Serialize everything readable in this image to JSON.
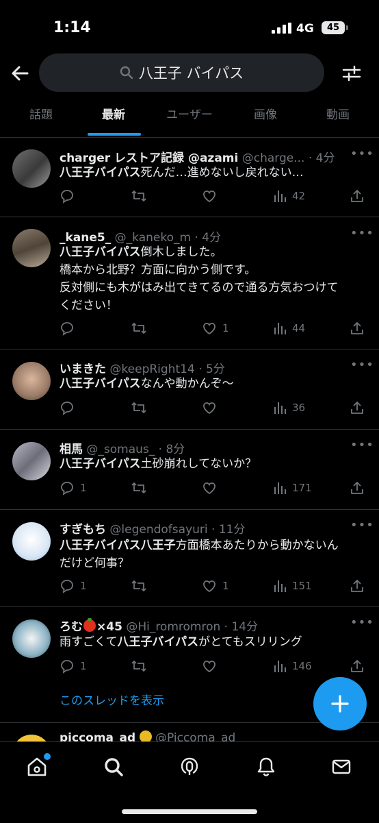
{
  "status": {
    "time": "1:14",
    "network": "4G",
    "battery": "45"
  },
  "search": {
    "query": "八王子 バイパス"
  },
  "tabs": [
    "話題",
    "最新",
    "ユーザー",
    "画像",
    "動画"
  ],
  "tweets": [
    {
      "name": "charger レストア記録 @azami",
      "meta": "@charge... · 4分",
      "text_bold": "八王子バイパス",
      "text": "死んだ…進めないし戻れない…",
      "replies": "",
      "likes": "",
      "views": "42"
    },
    {
      "name": "_kane5_",
      "meta": "@_kaneko_m · 4分",
      "text_bold": "八王子バイパス",
      "text": "倒木しました。",
      "lines": [
        "橋本から北野？方面に向かう側です。",
        "反対側にも木がはみ出てきてるので通る方気おつけて",
        "ください！"
      ],
      "replies": "",
      "likes": "1",
      "views": "44"
    },
    {
      "name": "いまきた",
      "meta": "@keepRight14 · 5分",
      "text_bold": "八王子バイパス",
      "text": "なんや動かんぞ〜",
      "replies": "",
      "likes": "",
      "views": "36"
    },
    {
      "name": "相馬",
      "meta": "@_somaus_ · 8分",
      "text_bold": "八王子バイパス",
      "text": "土砂崩れしてないか？",
      "replies": "1",
      "likes": "",
      "views": "171"
    },
    {
      "name": "すぎもち",
      "meta": "@legendofsayuri · 11分",
      "text_bold": "八王子バイパス八王子",
      "text": "方面橋本あたりから動かないん",
      "line2": "だけど何事？",
      "replies": "1",
      "likes": "1",
      "views": "151"
    },
    {
      "name_pre": "ろむ",
      "name_post": "×45",
      "meta": "@Hi_romromron · 14分",
      "text_pre": "雨すごくて",
      "text_bold": "八王子バイパス",
      "text": "がとてもスリリング",
      "replies": "1",
      "likes": "",
      "views": "146"
    }
  ],
  "thread_link": "このスレッドを表示",
  "ad": {
    "name": "piccoma_ad",
    "meta": "@Piccoma_ad"
  },
  "colors": {
    "accent": "#1d9bf0",
    "muted": "#71767b",
    "text": "#e7e9ea",
    "divider": "#2f3336"
  }
}
